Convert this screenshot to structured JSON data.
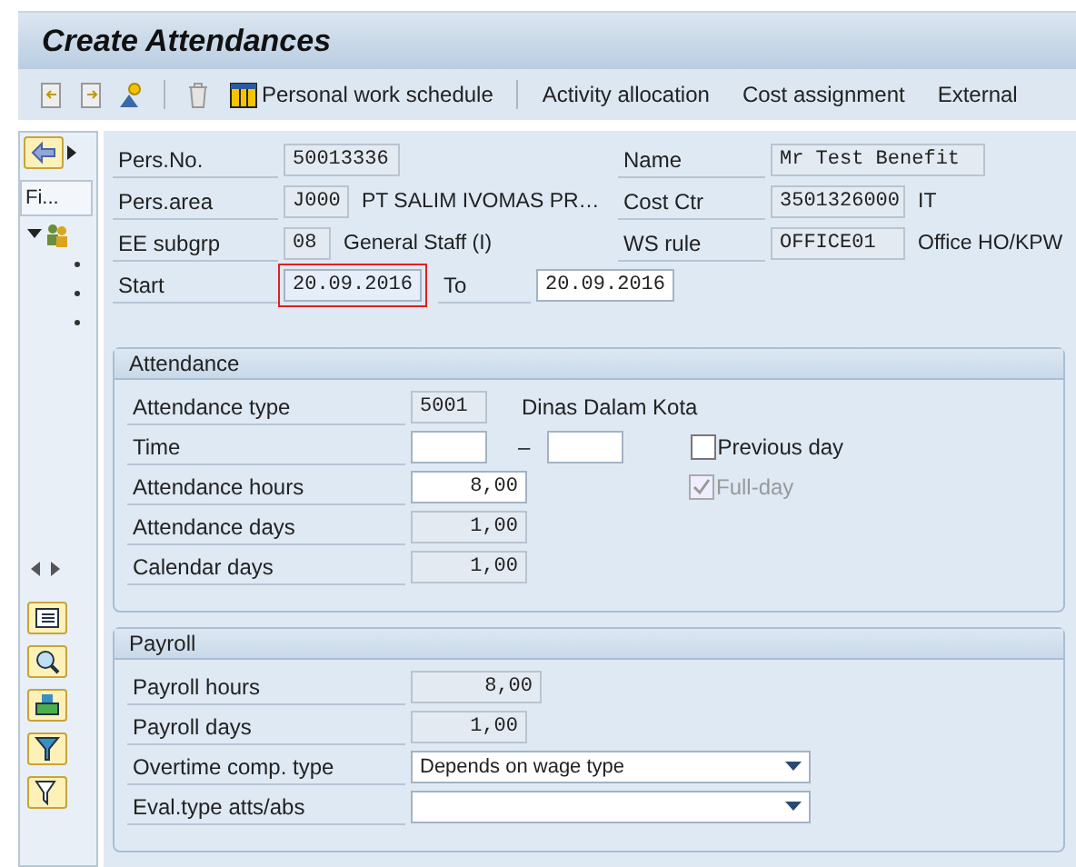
{
  "window": {
    "title": "Create Attendances"
  },
  "toolbar": {
    "buttons": [
      "Personal work schedule",
      "Activity allocation",
      "Cost assignment",
      "External"
    ]
  },
  "navigator": {
    "tab": "Fi...",
    "tree": {
      "expanded": true
    }
  },
  "header": {
    "left": [
      {
        "label": "Pers.No.",
        "value": "50013336",
        "readonly": true
      },
      {
        "label": "Pers.area",
        "value": "J000",
        "readonly": true,
        "text": "PT SALIM IVOMAS PR…"
      },
      {
        "label": "EE subgrp",
        "value": "08",
        "readonly": true,
        "text": "General Staff (I)"
      }
    ],
    "right": [
      {
        "label": "Name",
        "value": "Mr Test Benefit",
        "readonly": true
      },
      {
        "label": "Cost Ctr",
        "value": "3501326000",
        "readonly": true,
        "text": "IT"
      },
      {
        "label": "WS rule",
        "value": "OFFICE01",
        "readonly": true,
        "text": "Office HO/KPW"
      }
    ],
    "period": {
      "label": "Start",
      "value": "20.09.2016",
      "focused": true,
      "to_label": "To",
      "to_value": "20.09.2016"
    }
  },
  "attendance": {
    "title": "Attendance",
    "rows": [
      {
        "kind": "code",
        "label": "Attendance type",
        "value": "5001",
        "readonly": true,
        "text": "Dinas Dalam Kota"
      },
      {
        "kind": "range",
        "label": "Time",
        "separator": "–",
        "checkbox": {
          "label": "Previous day",
          "checked": false,
          "disabled": false
        }
      },
      {
        "kind": "number",
        "label": "Attendance hours",
        "value": "8,00",
        "readonly": false,
        "checkbox": {
          "label": "Full-day",
          "checked": true,
          "disabled": true
        }
      },
      {
        "kind": "number",
        "label": "Attendance days",
        "value": "1,00",
        "readonly": true
      },
      {
        "kind": "number",
        "label": "Calendar days",
        "value": "1,00",
        "readonly": true
      }
    ]
  },
  "payroll": {
    "title": "Payroll",
    "rows": [
      {
        "kind": "wide",
        "label": "Payroll hours",
        "value": "8,00",
        "readonly": true
      },
      {
        "kind": "number",
        "label": "Payroll days",
        "value": "1,00",
        "readonly": true
      },
      {
        "kind": "dropdown",
        "label": "Overtime comp. type",
        "value": "Depends on wage type"
      },
      {
        "kind": "dropdown",
        "label": "Eval.type atts/abs"
      }
    ]
  }
}
